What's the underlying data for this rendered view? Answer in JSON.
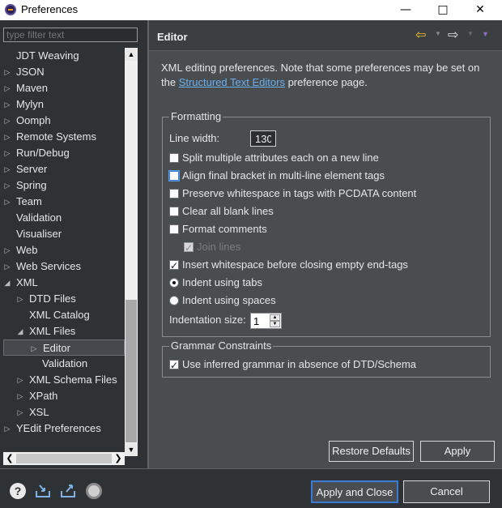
{
  "window": {
    "title": "Preferences"
  },
  "filter": {
    "placeholder": "type filter text"
  },
  "tree": [
    {
      "label": "JDT Weaving",
      "arrow": "",
      "level": 1
    },
    {
      "label": "JSON",
      "arrow": "▷",
      "level": 1
    },
    {
      "label": "Maven",
      "arrow": "▷",
      "level": 1
    },
    {
      "label": "Mylyn",
      "arrow": "▷",
      "level": 1
    },
    {
      "label": "Oomph",
      "arrow": "▷",
      "level": 1
    },
    {
      "label": "Remote Systems",
      "arrow": "▷",
      "level": 1
    },
    {
      "label": "Run/Debug",
      "arrow": "▷",
      "level": 1
    },
    {
      "label": "Server",
      "arrow": "▷",
      "level": 1
    },
    {
      "label": "Spring",
      "arrow": "▷",
      "level": 1
    },
    {
      "label": "Team",
      "arrow": "▷",
      "level": 1
    },
    {
      "label": "Validation",
      "arrow": "",
      "level": 1
    },
    {
      "label": "Visualiser",
      "arrow": "",
      "level": 1
    },
    {
      "label": "Web",
      "arrow": "▷",
      "level": 1
    },
    {
      "label": "Web Services",
      "arrow": "▷",
      "level": 1
    },
    {
      "label": "XML",
      "arrow": "◢",
      "level": 1
    },
    {
      "label": "DTD Files",
      "arrow": "▷",
      "level": 2
    },
    {
      "label": "XML Catalog",
      "arrow": "",
      "level": 2
    },
    {
      "label": "XML Files",
      "arrow": "◢",
      "level": 2
    },
    {
      "label": "Editor",
      "arrow": "▷",
      "level": 3,
      "selected": true
    },
    {
      "label": "Validation",
      "arrow": "",
      "level": 3
    },
    {
      "label": "XML Schema Files",
      "arrow": "▷",
      "level": 2
    },
    {
      "label": "XPath",
      "arrow": "▷",
      "level": 2
    },
    {
      "label": "XSL",
      "arrow": "▷",
      "level": 2
    },
    {
      "label": "YEdit Preferences",
      "arrow": "▷",
      "level": 1
    }
  ],
  "page": {
    "title": "Editor",
    "desc_prefix": "XML editing preferences.  Note that some preferences may be set on the ",
    "desc_link": "Structured Text Editors",
    "desc_suffix": " preference page."
  },
  "formatting": {
    "legend": "Formatting",
    "line_width_label": "Line width:",
    "line_width_value": "130",
    "split_attrs": "Split multiple attributes each on a new line",
    "align_bracket": "Align final bracket in multi-line element tags",
    "preserve_ws": "Preserve whitespace in tags with PCDATA content",
    "clear_blank": "Clear all blank lines",
    "format_comments": "Format comments",
    "join_lines": "Join lines",
    "insert_ws": "Insert whitespace before closing empty end-tags",
    "indent_tabs": "Indent using tabs",
    "indent_spaces": "Indent using spaces",
    "indent_size_label": "Indentation size:",
    "indent_size_value": "1"
  },
  "grammar": {
    "legend": "Grammar Constraints",
    "use_inferred": "Use inferred grammar in absence of DTD/Schema"
  },
  "buttons": {
    "restore": "Restore Defaults",
    "apply": "Apply",
    "apply_close": "Apply and Close",
    "cancel": "Cancel"
  },
  "colors": {
    "accent": "#3a7bd5",
    "link": "#6ab0f0",
    "nav_arrow": "#f2c230"
  }
}
